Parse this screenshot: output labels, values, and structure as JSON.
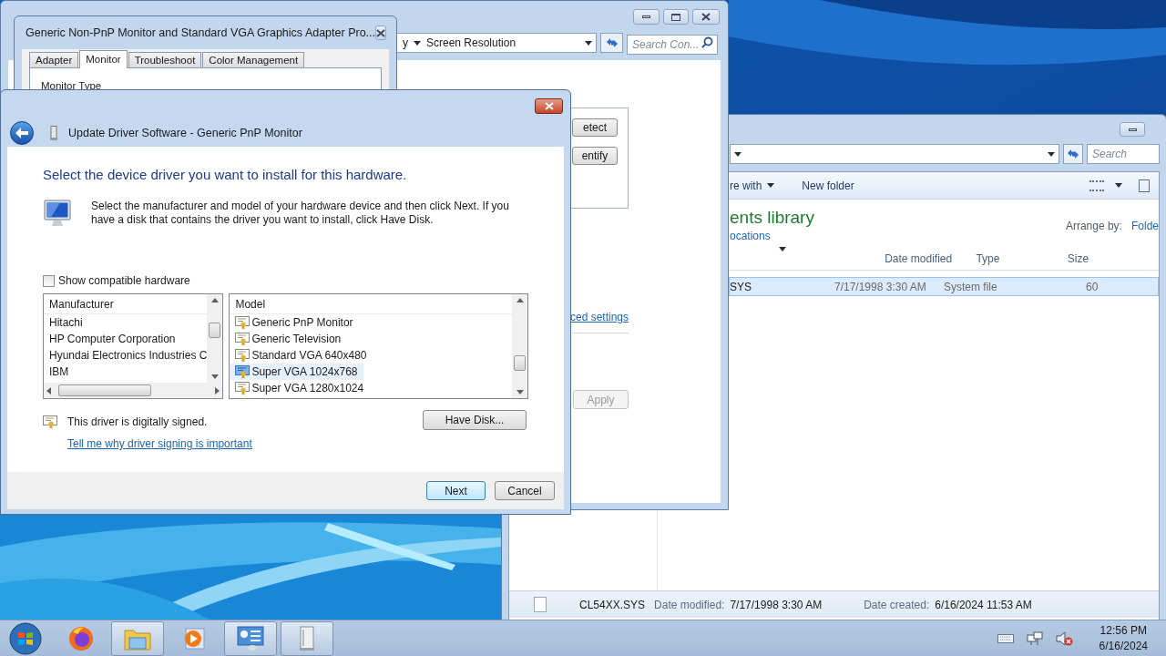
{
  "screen_resolution": {
    "breadcrumb": [
      "y",
      "Screen Resolution"
    ],
    "search": {
      "placeholder": "Search Con..."
    },
    "buttons": [
      "etect",
      "entify"
    ],
    "link": "ced settings",
    "apply": {
      "label": "Apply",
      "disabled": true
    }
  },
  "display_properties": {
    "title": "Generic Non-PnP Monitor and Standard VGA Graphics Adapter Pro...",
    "tabs": [
      {
        "label": "Adapter",
        "selected": false
      },
      {
        "label": "Monitor",
        "selected": true
      },
      {
        "label": "Troubleshoot",
        "selected": false
      },
      {
        "label": "Color Management",
        "selected": false
      }
    ],
    "group_label": "Monitor Type"
  },
  "update_driver": {
    "title": "Update Driver Software - Generic PnP Monitor",
    "heading": "Select the device driver you want to install for this hardware.",
    "instructions": "Select the manufacturer and model of your hardware device and then click Next. If you have a disk that contains the driver you want to install, click Have Disk.",
    "show_compatible": {
      "label": "Show compatible hardware",
      "checked": false
    },
    "manufacturer": {
      "header": "Manufacturer",
      "items": [
        "Hitachi",
        "HP Computer Corporation",
        "Hyundai Electronics Industries C",
        "IBM"
      ]
    },
    "model": {
      "header": "Model",
      "items": [
        {
          "label": "Generic PnP Monitor",
          "selected": false
        },
        {
          "label": "Generic Television",
          "selected": false
        },
        {
          "label": "Standard VGA 640x480",
          "selected": false
        },
        {
          "label": "Super VGA 1024x768",
          "selected": true
        },
        {
          "label": "Super VGA 1280x1024",
          "selected": false
        }
      ]
    },
    "signed_text": "This driver is digitally signed.",
    "signing_link": "Tell me why driver signing is important",
    "have_disk": "Have Disk...",
    "next": "Next",
    "cancel": "Cancel"
  },
  "explorer": {
    "search": {
      "placeholder": "Search"
    },
    "toolbar": [
      {
        "label": "re with",
        "dropdown": true
      },
      {
        "label": "New folder",
        "dropdown": false
      }
    ],
    "library": {
      "title": "ents library",
      "subtitle": "ocations",
      "arrange_label": "Arrange by:",
      "arrange_value": "Folde"
    },
    "columns": [
      "Date modified",
      "Type",
      "Size"
    ],
    "rows": [
      {
        "name": "SYS",
        "date": "7/17/1998 3:30 AM",
        "type": "System file",
        "size": "60",
        "selected": true
      }
    ],
    "details": {
      "name": "CL54XX.SYS",
      "fields": [
        {
          "label": "Date modified:",
          "value": "7/17/1998 3:30 AM"
        },
        {
          "label": "Date created:",
          "value": "6/16/2024 11:53 AM"
        }
      ]
    }
  },
  "taskbar": {
    "apps": [
      {
        "kind": "firefox",
        "running": false
      },
      {
        "kind": "explorer",
        "running": true
      },
      {
        "kind": "media",
        "running": false
      },
      {
        "kind": "control_panel",
        "running": true
      },
      {
        "kind": "device",
        "running": true
      }
    ],
    "tray": {
      "volume_muted": true
    },
    "time": "12:56 PM",
    "date": "6/16/2024"
  }
}
